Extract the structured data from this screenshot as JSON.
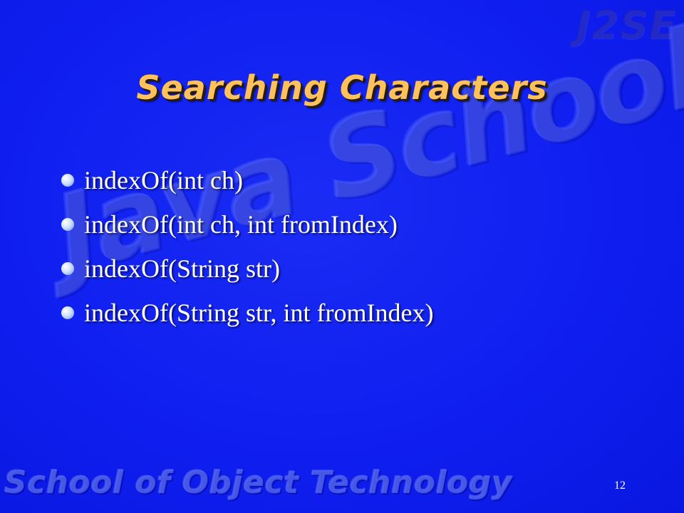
{
  "watermarks": {
    "corner": "J2SE",
    "center": "Java School",
    "footer": "School of Object Technology"
  },
  "slide": {
    "title": "Searching Characters",
    "bullets": [
      "indexOf(int ch)",
      "indexOf(int ch, int fromIndex)",
      "indexOf(String str)",
      "indexOf(String str, int fromIndex)"
    ],
    "page_number": "12"
  },
  "colors": {
    "background": "#1020ee",
    "title": "#ffc15a",
    "text": "#ffffff"
  }
}
